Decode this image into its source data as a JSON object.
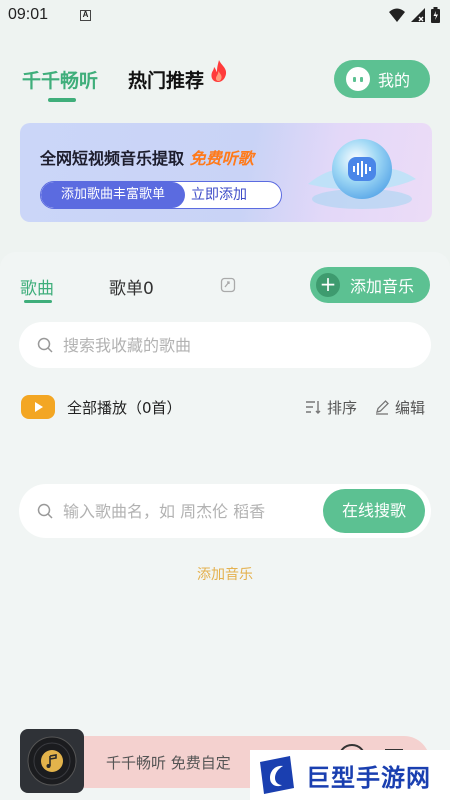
{
  "status_bar": {
    "time": "09:01",
    "notification_letter": "A"
  },
  "header": {
    "tab_main": "千千畅听",
    "tab_hot": "热门推荐",
    "mine_button": "我的"
  },
  "banner": {
    "title": "全网短视频音乐提取",
    "highlight": "免费听歌",
    "pill_left": "添加歌曲丰富歌单",
    "pill_right": "立即添加"
  },
  "panel": {
    "tab_songs": "歌曲",
    "tab_playlists": "歌单0",
    "add_music_button": "添加音乐",
    "search_placeholder": "搜索我收藏的歌曲",
    "play_all_label": "全部播放（0首）",
    "sort_label": "排序",
    "edit_label": "编辑",
    "online_search_placeholder": "输入歌曲名，如 周杰伦 稻香",
    "online_search_button": "在线搜歌",
    "add_music_link": "添加音乐"
  },
  "player": {
    "text": "千千畅听 免费自定"
  },
  "watermark": {
    "text": "巨型手游网"
  },
  "colors": {
    "accent": "#5cc192",
    "accent_dark": "#3fae7b",
    "highlight": "#ff7a1a",
    "play_all": "#f3a623",
    "link": "#e4b14f"
  }
}
